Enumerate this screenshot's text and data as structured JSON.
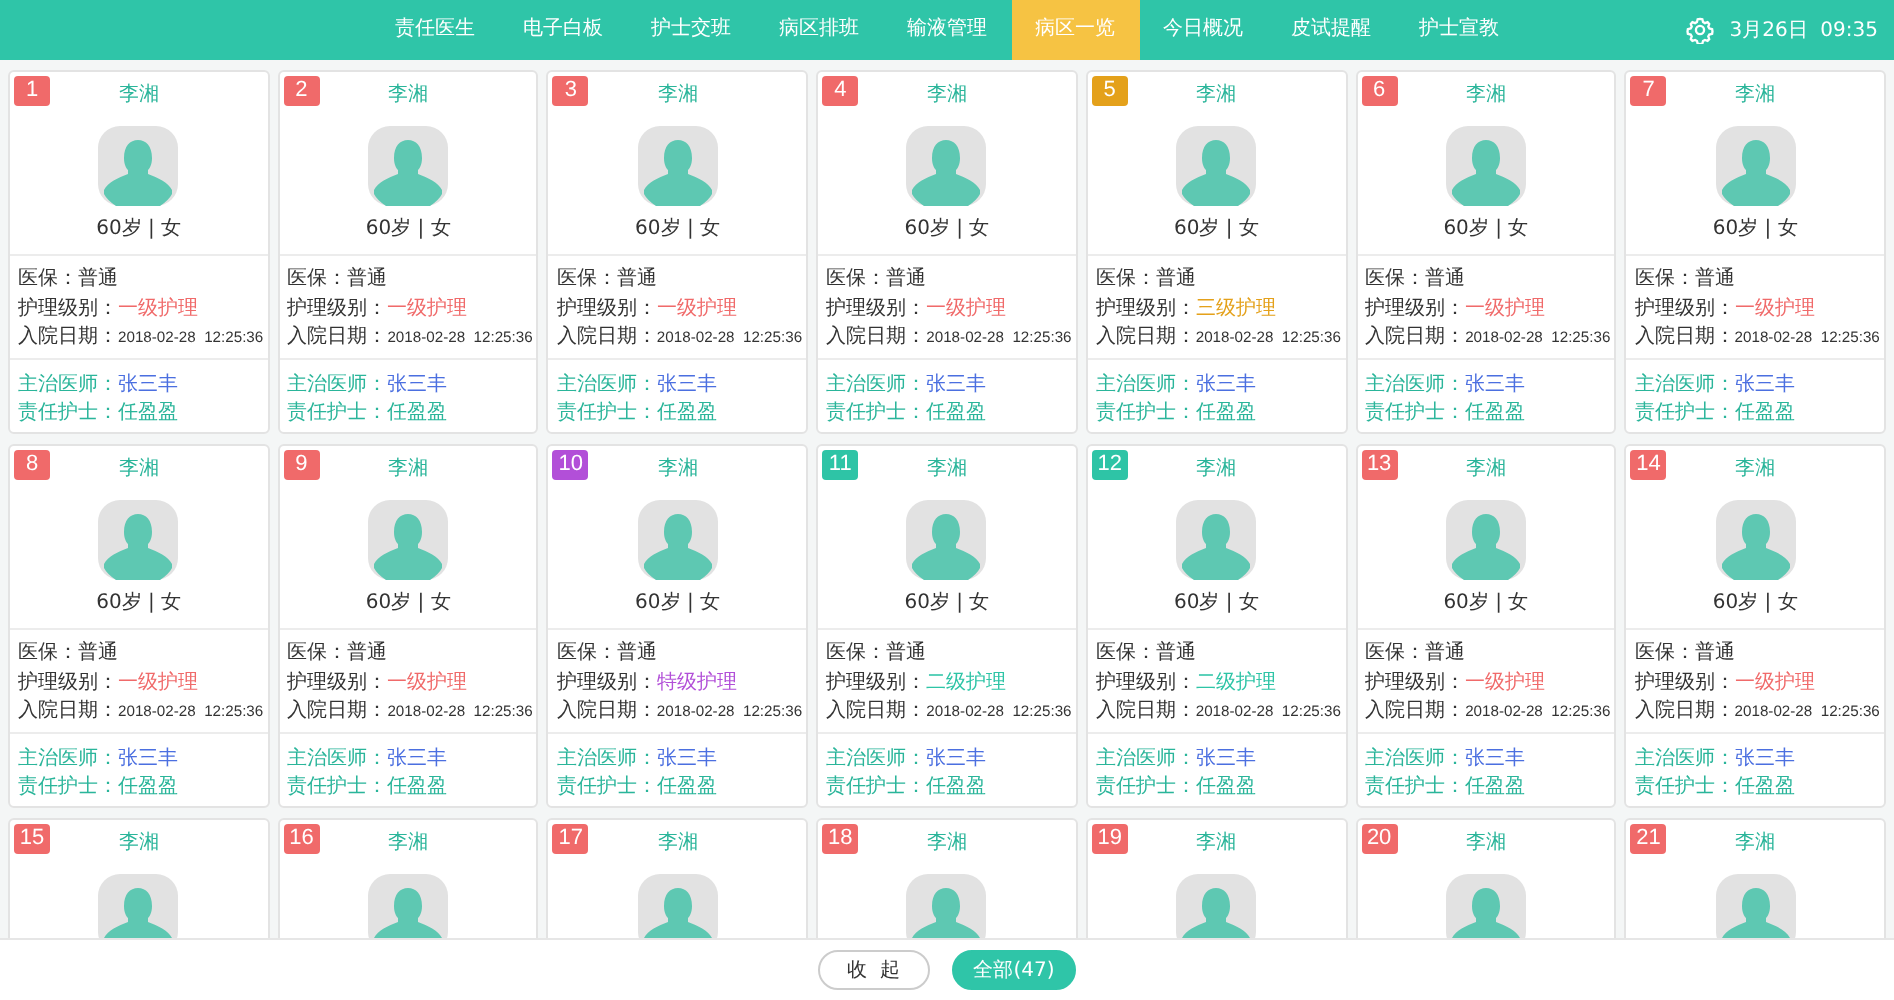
{
  "nav": {
    "items": [
      {
        "label": "责任医生",
        "selected": false
      },
      {
        "label": "电子白板",
        "selected": false
      },
      {
        "label": "护士交班",
        "selected": false
      },
      {
        "label": "病区排班",
        "selected": false
      },
      {
        "label": "输液管理",
        "selected": false
      },
      {
        "label": "病区一览",
        "selected": true
      },
      {
        "label": "今日概况",
        "selected": false
      },
      {
        "label": "皮试提醒",
        "selected": false
      },
      {
        "label": "护士宣教",
        "selected": false
      }
    ],
    "date_time": "3月26日  09:35"
  },
  "patients": [
    {
      "number": "1",
      "color": "#f06a6a",
      "name": "李湘",
      "age_sex": "60岁 | 女",
      "fields": [
        {
          "kind": "plain",
          "label": "医保：",
          "value": "普通"
        },
        {
          "kind": "level",
          "label": "护理级别：",
          "value": "一级护理"
        },
        {
          "kind": "date",
          "label": "入院日期：",
          "value": "2018-02-28  12:25:36"
        }
      ],
      "staff": [
        {
          "kind": "doctor",
          "label": "主治医师：",
          "value": "张三丰"
        },
        {
          "kind": "nurse",
          "label": "责任护士：",
          "value": "任盈盈"
        }
      ]
    },
    {
      "number": "2",
      "color": "#f06a6a",
      "name": "李湘",
      "age_sex": "60岁 | 女",
      "fields": [
        {
          "kind": "plain",
          "label": "医保：",
          "value": "普通"
        },
        {
          "kind": "level",
          "label": "护理级别：",
          "value": "一级护理"
        },
        {
          "kind": "date",
          "label": "入院日期：",
          "value": "2018-02-28  12:25:36"
        }
      ],
      "staff": [
        {
          "kind": "doctor",
          "label": "主治医师：",
          "value": "张三丰"
        },
        {
          "kind": "nurse",
          "label": "责任护士：",
          "value": "任盈盈"
        }
      ]
    },
    {
      "number": "3",
      "color": "#f06a6a",
      "name": "李湘",
      "age_sex": "60岁 | 女",
      "fields": [
        {
          "kind": "plain",
          "label": "医保：",
          "value": "普通"
        },
        {
          "kind": "level",
          "label": "护理级别：",
          "value": "一级护理"
        },
        {
          "kind": "date",
          "label": "入院日期：",
          "value": "2018-02-28  12:25:36"
        }
      ],
      "staff": [
        {
          "kind": "doctor",
          "label": "主治医师：",
          "value": "张三丰"
        },
        {
          "kind": "nurse",
          "label": "责任护士：",
          "value": "任盈盈"
        }
      ]
    },
    {
      "number": "4",
      "color": "#f06a6a",
      "name": "李湘",
      "age_sex": "60岁 | 女",
      "fields": [
        {
          "kind": "plain",
          "label": "医保：",
          "value": "普通"
        },
        {
          "kind": "level",
          "label": "护理级别：",
          "value": "一级护理"
        },
        {
          "kind": "date",
          "label": "入院日期：",
          "value": "2018-02-28  12:25:36"
        }
      ],
      "staff": [
        {
          "kind": "doctor",
          "label": "主治医师：",
          "value": "张三丰"
        },
        {
          "kind": "nurse",
          "label": "责任护士：",
          "value": "任盈盈"
        }
      ]
    },
    {
      "number": "5",
      "color": "#e4a11b",
      "name": "李湘",
      "age_sex": "60岁 | 女",
      "fields": [
        {
          "kind": "plain",
          "label": "医保：",
          "value": "普通"
        },
        {
          "kind": "level",
          "label": "护理级别：",
          "value": "三级护理"
        },
        {
          "kind": "date",
          "label": "入院日期：",
          "value": "2018-02-28  12:25:36"
        }
      ],
      "staff": [
        {
          "kind": "doctor",
          "label": "主治医师：",
          "value": "张三丰"
        },
        {
          "kind": "nurse",
          "label": "责任护士：",
          "value": "任盈盈"
        }
      ]
    },
    {
      "number": "6",
      "color": "#f06a6a",
      "name": "李湘",
      "age_sex": "60岁 | 女",
      "fields": [
        {
          "kind": "plain",
          "label": "医保：",
          "value": "普通"
        },
        {
          "kind": "level",
          "label": "护理级别：",
          "value": "一级护理"
        },
        {
          "kind": "date",
          "label": "入院日期：",
          "value": "2018-02-28  12:25:36"
        }
      ],
      "staff": [
        {
          "kind": "doctor",
          "label": "主治医师：",
          "value": "张三丰"
        },
        {
          "kind": "nurse",
          "label": "责任护士：",
          "value": "任盈盈"
        }
      ]
    },
    {
      "number": "7",
      "color": "#f06a6a",
      "name": "李湘",
      "age_sex": "60岁 | 女",
      "fields": [
        {
          "kind": "plain",
          "label": "医保：",
          "value": "普通"
        },
        {
          "kind": "level",
          "label": "护理级别：",
          "value": "一级护理"
        },
        {
          "kind": "date",
          "label": "入院日期：",
          "value": "2018-02-28  12:25:36"
        }
      ],
      "staff": [
        {
          "kind": "doctor",
          "label": "主治医师：",
          "value": "张三丰"
        },
        {
          "kind": "nurse",
          "label": "责任护士：",
          "value": "任盈盈"
        }
      ]
    },
    {
      "number": "8",
      "color": "#f06a6a",
      "name": "李湘",
      "age_sex": "60岁 | 女",
      "fields": [
        {
          "kind": "plain",
          "label": "医保：",
          "value": "普通"
        },
        {
          "kind": "level",
          "label": "护理级别：",
          "value": "一级护理"
        },
        {
          "kind": "date",
          "label": "入院日期：",
          "value": "2018-02-28  12:25:36"
        }
      ],
      "staff": [
        {
          "kind": "doctor",
          "label": "主治医师：",
          "value": "张三丰"
        },
        {
          "kind": "nurse",
          "label": "责任护士：",
          "value": "任盈盈"
        }
      ]
    },
    {
      "number": "9",
      "color": "#f06a6a",
      "name": "李湘",
      "age_sex": "60岁 | 女",
      "fields": [
        {
          "kind": "plain",
          "label": "医保：",
          "value": "普通"
        },
        {
          "kind": "level",
          "label": "护理级别：",
          "value": "一级护理"
        },
        {
          "kind": "date",
          "label": "入院日期：",
          "value": "2018-02-28  12:25:36"
        }
      ],
      "staff": [
        {
          "kind": "doctor",
          "label": "主治医师：",
          "value": "张三丰"
        },
        {
          "kind": "nurse",
          "label": "责任护士：",
          "value": "任盈盈"
        }
      ]
    },
    {
      "number": "10",
      "color": "#b24fd8",
      "name": "李湘",
      "age_sex": "60岁 | 女",
      "fields": [
        {
          "kind": "plain",
          "label": "医保：",
          "value": "普通"
        },
        {
          "kind": "level",
          "label": "护理级别：",
          "value": "特级护理"
        },
        {
          "kind": "date",
          "label": "入院日期：",
          "value": "2018-02-28  12:25:36"
        }
      ],
      "staff": [
        {
          "kind": "doctor",
          "label": "主治医师：",
          "value": "张三丰"
        },
        {
          "kind": "nurse",
          "label": "责任护士：",
          "value": "任盈盈"
        }
      ]
    },
    {
      "number": "11",
      "color": "#2ec4a6",
      "name": "李湘",
      "age_sex": "60岁 | 女",
      "fields": [
        {
          "kind": "plain",
          "label": "医保：",
          "value": "普通"
        },
        {
          "kind": "level",
          "label": "护理级别：",
          "value": "二级护理"
        },
        {
          "kind": "date",
          "label": "入院日期：",
          "value": "2018-02-28  12:25:36"
        }
      ],
      "staff": [
        {
          "kind": "doctor",
          "label": "主治医师：",
          "value": "张三丰"
        },
        {
          "kind": "nurse",
          "label": "责任护士：",
          "value": "任盈盈"
        }
      ]
    },
    {
      "number": "12",
      "color": "#2ec4a6",
      "name": "李湘",
      "age_sex": "60岁 | 女",
      "fields": [
        {
          "kind": "plain",
          "label": "医保：",
          "value": "普通"
        },
        {
          "kind": "level",
          "label": "护理级别：",
          "value": "二级护理"
        },
        {
          "kind": "date",
          "label": "入院日期：",
          "value": "2018-02-28  12:25:36"
        }
      ],
      "staff": [
        {
          "kind": "doctor",
          "label": "主治医师：",
          "value": "张三丰"
        },
        {
          "kind": "nurse",
          "label": "责任护士：",
          "value": "任盈盈"
        }
      ]
    },
    {
      "number": "13",
      "color": "#f06a6a",
      "name": "李湘",
      "age_sex": "60岁 | 女",
      "fields": [
        {
          "kind": "plain",
          "label": "医保：",
          "value": "普通"
        },
        {
          "kind": "level",
          "label": "护理级别：",
          "value": "一级护理"
        },
        {
          "kind": "date",
          "label": "入院日期：",
          "value": "2018-02-28  12:25:36"
        }
      ],
      "staff": [
        {
          "kind": "doctor",
          "label": "主治医师：",
          "value": "张三丰"
        },
        {
          "kind": "nurse",
          "label": "责任护士：",
          "value": "任盈盈"
        }
      ]
    },
    {
      "number": "14",
      "color": "#f06a6a",
      "name": "李湘",
      "age_sex": "60岁 | 女",
      "fields": [
        {
          "kind": "plain",
          "label": "医保：",
          "value": "普通"
        },
        {
          "kind": "level",
          "label": "护理级别：",
          "value": "一级护理"
        },
        {
          "kind": "date",
          "label": "入院日期：",
          "value": "2018-02-28  12:25:36"
        }
      ],
      "staff": [
        {
          "kind": "doctor",
          "label": "主治医师：",
          "value": "张三丰"
        },
        {
          "kind": "nurse",
          "label": "责任护士：",
          "value": "任盈盈"
        }
      ]
    },
    {
      "number": "15",
      "color": "#f06a6a",
      "name": "李湘"
    },
    {
      "number": "16",
      "color": "#f06a6a",
      "name": "李湘"
    },
    {
      "number": "17",
      "color": "#f06a6a",
      "name": "李湘"
    },
    {
      "number": "18",
      "color": "#f06a6a",
      "name": "李湘"
    },
    {
      "number": "19",
      "color": "#f06a6a",
      "name": "李湘"
    },
    {
      "number": "20",
      "color": "#f06a6a",
      "name": "李湘"
    },
    {
      "number": "21",
      "color": "#f06a6a",
      "name": "李湘"
    }
  ],
  "footer": {
    "buttons": [
      {
        "label": "收  起",
        "selected": false
      },
      {
        "label": "全部(47)",
        "selected": true
      }
    ]
  }
}
